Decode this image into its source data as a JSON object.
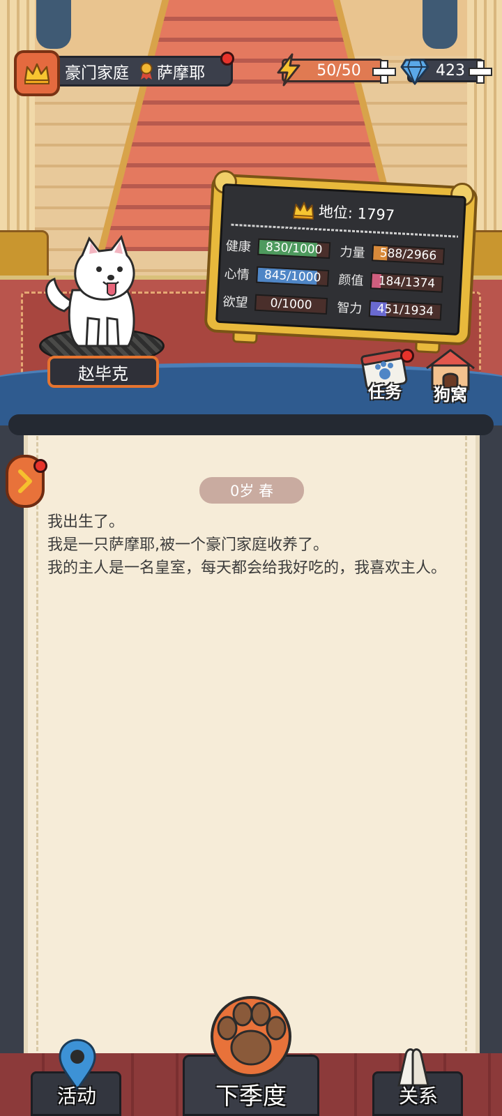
{
  "top_bar": {
    "family_name": "豪门家庭",
    "breed": "萨摩耶",
    "energy": "50/50",
    "gems": "423"
  },
  "dog": {
    "name": "赵毕克"
  },
  "stats_board": {
    "status_label": "地位: 1797",
    "stats": [
      {
        "label": "健康",
        "value": "830/1000",
        "fraction": 0.83,
        "color": "#4e9a5e"
      },
      {
        "label": "力量",
        "value": "588/2966",
        "fraction": 0.198,
        "color": "#d88a3a"
      },
      {
        "label": "心情",
        "value": "845/1000",
        "fraction": 0.845,
        "color": "#4f86c6"
      },
      {
        "label": "颜值",
        "value": "184/1374",
        "fraction": 0.134,
        "color": "#cf5e7e"
      },
      {
        "label": "欲望",
        "value": "0/1000",
        "fraction": 0.0,
        "color": "#b07acb"
      },
      {
        "label": "智力",
        "value": "451/1934",
        "fraction": 0.233,
        "color": "#6a6ad0"
      }
    ]
  },
  "side_buttons": {
    "tasks": "任务",
    "kennel": "狗窝"
  },
  "story": {
    "season": "0岁 春",
    "lines": [
      "我出生了。",
      "我是一只萨摩耶,被一个豪门家庭收养了。",
      "我的主人是一名皇室，每天都会给我好吃的，我喜欢主人。"
    ]
  },
  "bottom_nav": {
    "activities": "活动",
    "next_season": "下季度",
    "relations": "关系"
  }
}
